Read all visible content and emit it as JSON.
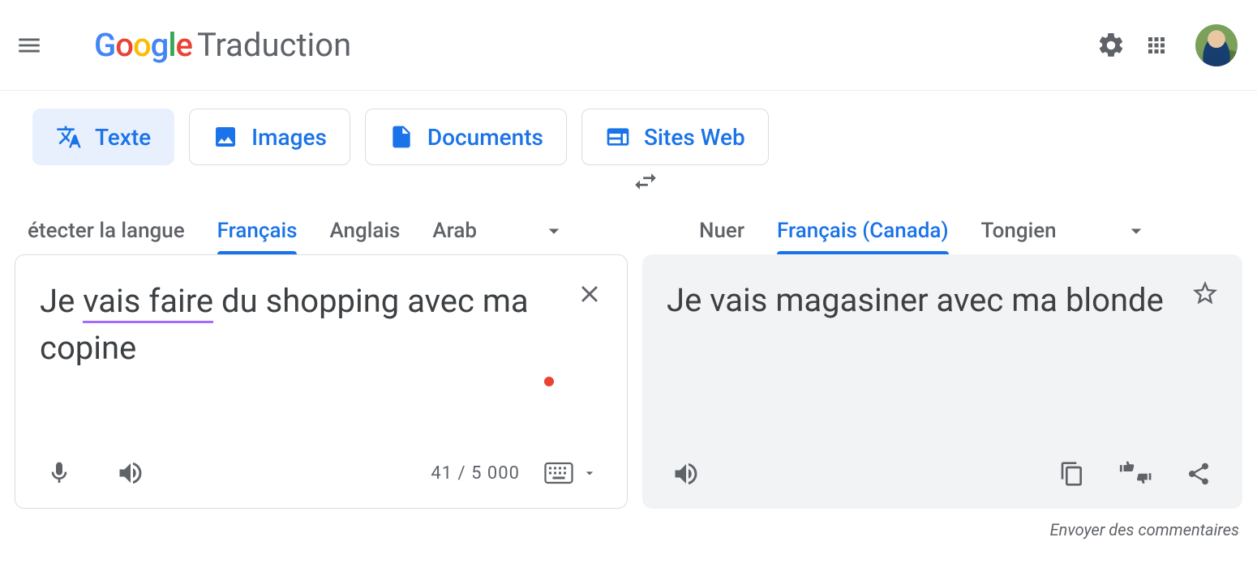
{
  "header": {
    "product_name": "Traduction"
  },
  "type_tabs": [
    {
      "id": "text",
      "label": "Texte",
      "icon": "translate"
    },
    {
      "id": "images",
      "label": "Images",
      "icon": "image"
    },
    {
      "id": "documents",
      "label": "Documents",
      "icon": "file"
    },
    {
      "id": "websites",
      "label": "Sites Web",
      "icon": "web"
    }
  ],
  "source": {
    "tabs": {
      "detect": "étecter la langue",
      "lang1": "Français",
      "lang2": "Anglais",
      "lang3": "Arab"
    },
    "active": "lang1",
    "text_pre": "Je ",
    "text_underlined": "vais faire",
    "text_post": " du shopping avec ma copine",
    "char_count": "41 / 5 000"
  },
  "target": {
    "tabs": {
      "lang1": "Nuer",
      "lang2": "Français (Canada)",
      "lang3": "Tongien"
    },
    "active": "lang2",
    "text": "Je vais magasiner avec ma blonde"
  },
  "footer": {
    "feedback": "Envoyer des commentaires"
  }
}
